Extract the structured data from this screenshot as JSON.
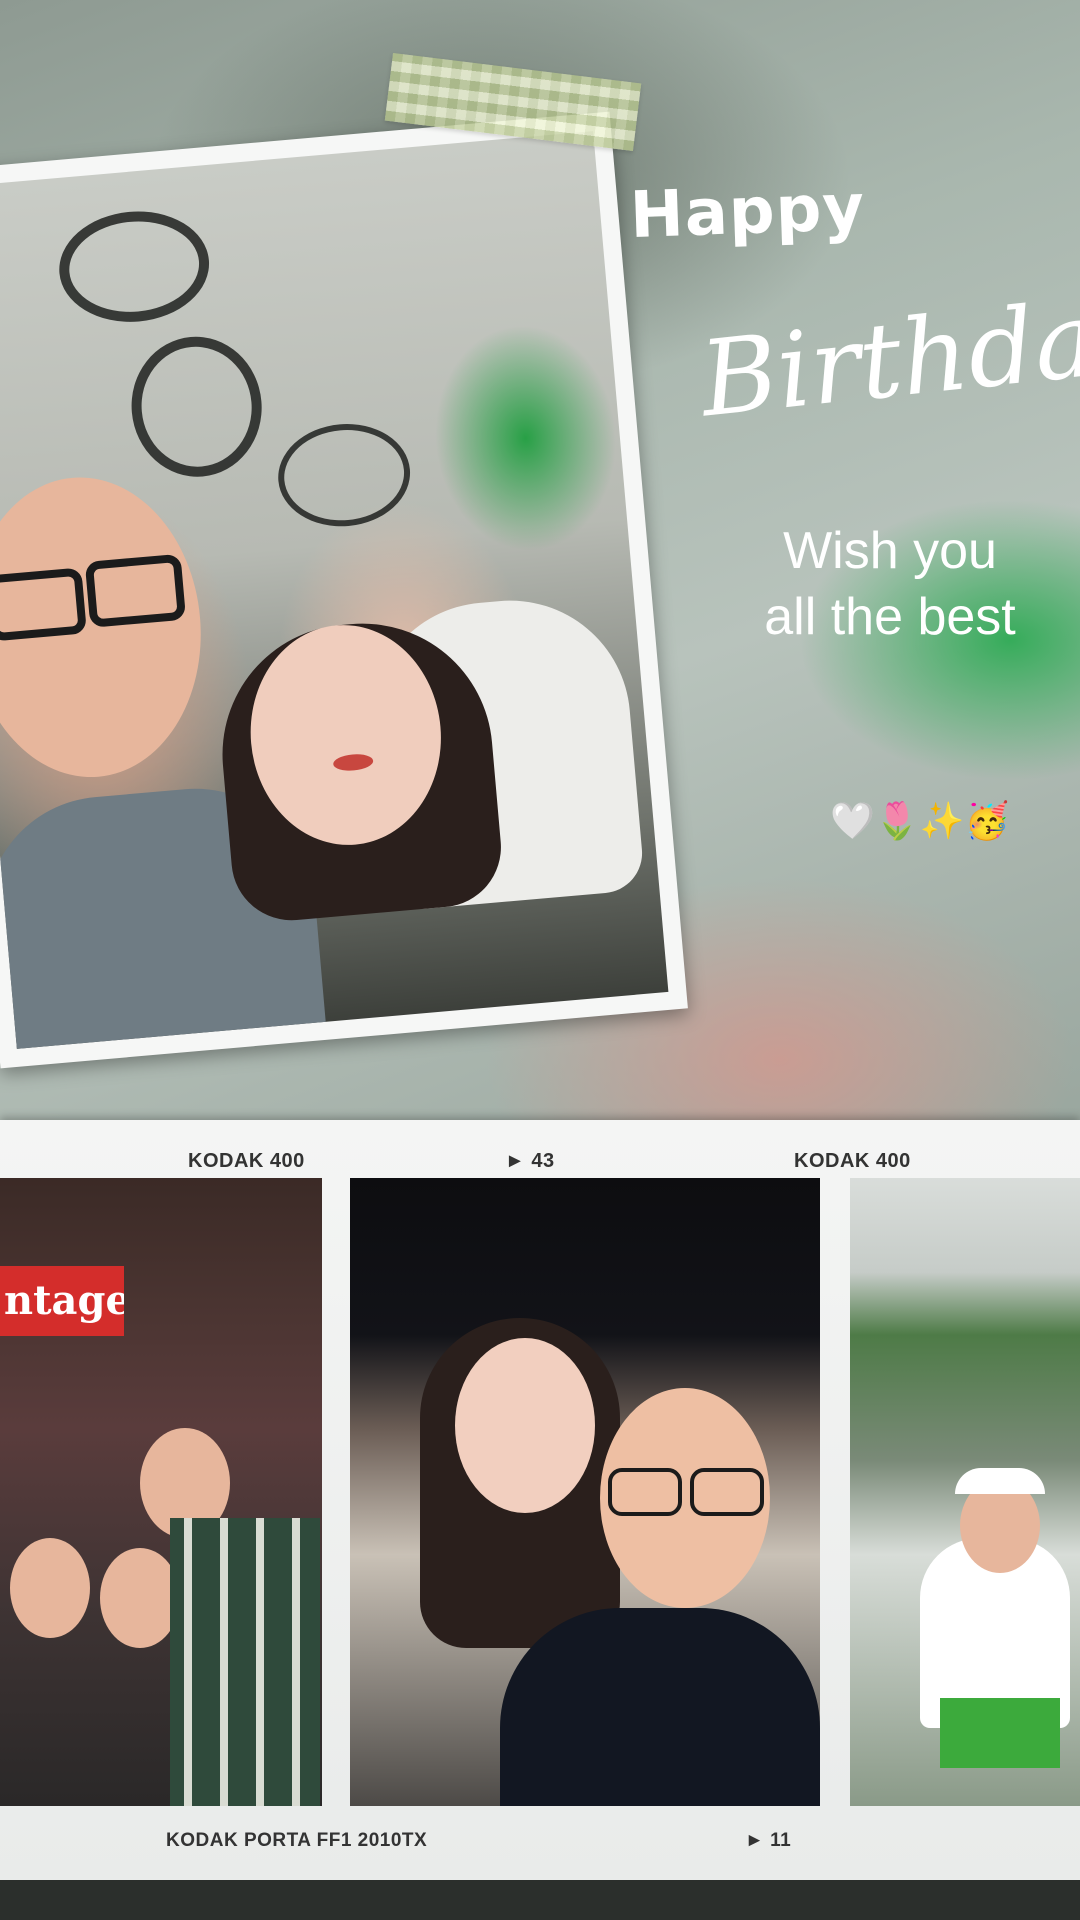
{
  "story": {
    "greeting_line1": "Happy",
    "greeting_line2": "Birthday",
    "wish_line1": "Wish you",
    "wish_line2": "all the best",
    "emojis": "🤍🌷✨🥳"
  },
  "film_strip": {
    "top_labels": [
      "KODAK 400",
      "► 43",
      "KODAK 400"
    ],
    "bottom_left_label": "KODAK PORTA   FF1   2010TX",
    "bottom_right_label": "► 11",
    "frame1_sign": "ntage"
  },
  "colors": {
    "text": "#ffffff",
    "film_base": "#f4f5f4",
    "accent_green": "#28aa50"
  }
}
